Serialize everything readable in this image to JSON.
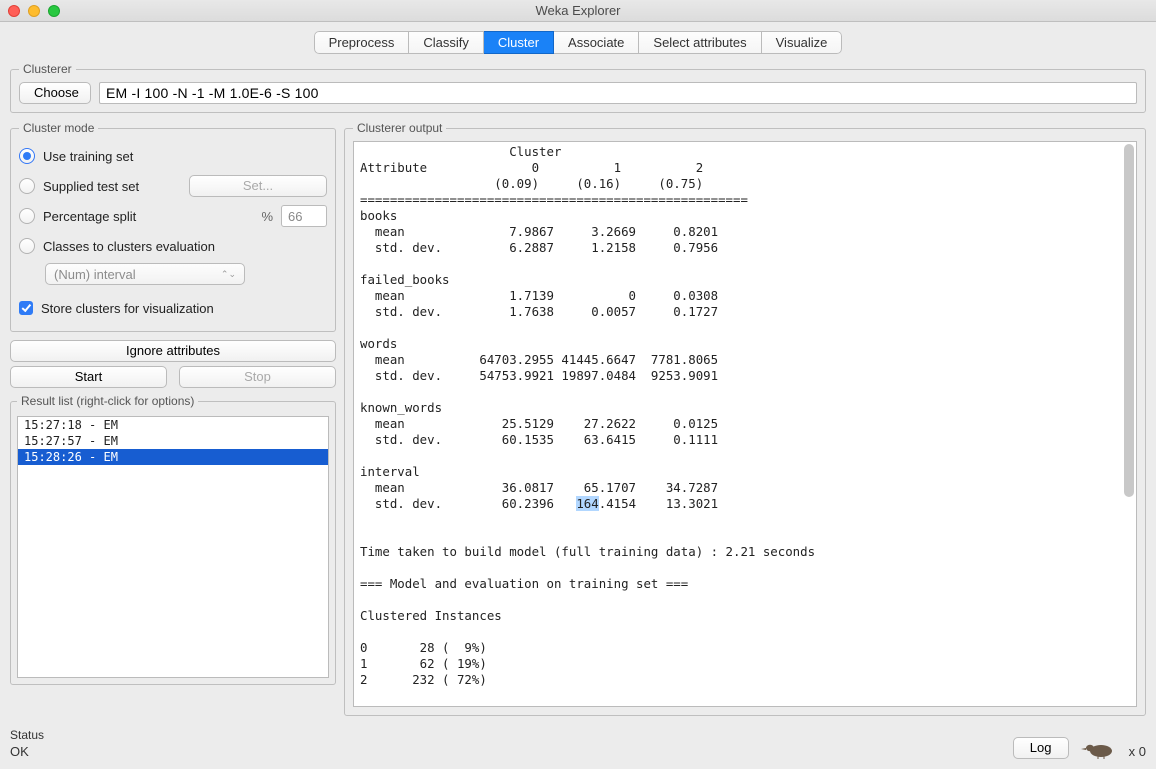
{
  "window": {
    "title": "Weka Explorer"
  },
  "tabs": [
    {
      "label": "Preprocess",
      "active": false
    },
    {
      "label": "Classify",
      "active": false
    },
    {
      "label": "Cluster",
      "active": true
    },
    {
      "label": "Associate",
      "active": false
    },
    {
      "label": "Select attributes",
      "active": false
    },
    {
      "label": "Visualize",
      "active": false
    }
  ],
  "clusterer_panel": {
    "legend": "Clusterer",
    "choose_label": "Choose",
    "options_text": "EM -I 100 -N -1 -M 1.0E-6 -S 100"
  },
  "mode_panel": {
    "legend": "Cluster mode",
    "radios": {
      "training": "Use training set",
      "supplied": "Supplied test set",
      "percentage": "Percentage split",
      "classes": "Classes to clusters evaluation"
    },
    "set_button": "Set...",
    "pct_symbol": "%",
    "pct_value": "66",
    "class_attr": "(Num) interval",
    "store_checkbox": "Store clusters for visualization",
    "ignore_button": "Ignore attributes",
    "start_button": "Start",
    "stop_button": "Stop"
  },
  "result_panel": {
    "legend": "Result list (right-click for options)",
    "items": [
      {
        "label": "15:27:18 - EM",
        "selected": false
      },
      {
        "label": "15:27:57 - EM",
        "selected": false
      },
      {
        "label": "15:28:26 - EM",
        "selected": true
      }
    ]
  },
  "output_panel": {
    "legend": "Clusterer output",
    "header_cluster": "Cluster",
    "header_attr": "Attribute",
    "cols": [
      "0",
      "1",
      "2"
    ],
    "weights": [
      "(0.09)",
      "(0.16)",
      "(0.75)"
    ],
    "rule": "====================================================",
    "attributes": [
      {
        "name": "books",
        "mean": [
          "7.9867",
          "3.2669",
          "0.8201"
        ],
        "sd": [
          "6.2887",
          "1.2158",
          "0.7956"
        ]
      },
      {
        "name": "failed_books",
        "mean": [
          "1.7139",
          "0",
          "0.0308"
        ],
        "sd": [
          "1.7638",
          "0.0057",
          "0.1727"
        ]
      },
      {
        "name": "words",
        "mean": [
          "64703.2955",
          "41445.6647",
          "7781.8065"
        ],
        "sd": [
          "54753.9921",
          "19897.0484",
          "9253.9091"
        ]
      },
      {
        "name": "known_words",
        "mean": [
          "25.5129",
          "27.2622",
          "0.0125"
        ],
        "sd": [
          "60.1535",
          "63.6415",
          "0.1111"
        ]
      },
      {
        "name": "interval",
        "mean": [
          "36.0817",
          "65.1707",
          "34.7287"
        ],
        "sd": [
          "60.2396",
          "164.4154",
          "13.3021"
        ]
      }
    ],
    "highlight": {
      "attr": "interval",
      "row": "sd",
      "col": 1,
      "text": "164"
    },
    "time_line": "Time taken to build model (full training data) : 2.21 seconds",
    "eval_header": "=== Model and evaluation on training set ===",
    "ci_header": "Clustered Instances",
    "clustered": [
      {
        "idx": "0",
        "count": "28",
        "pct": "9%"
      },
      {
        "idx": "1",
        "count": "62",
        "pct": "19%"
      },
      {
        "idx": "2",
        "count": "232",
        "pct": "72%"
      }
    ],
    "labels": {
      "mean": "mean",
      "sd": "std. dev."
    }
  },
  "status": {
    "legend": "Status",
    "value": "OK",
    "log_button": "Log",
    "count": "x 0"
  }
}
